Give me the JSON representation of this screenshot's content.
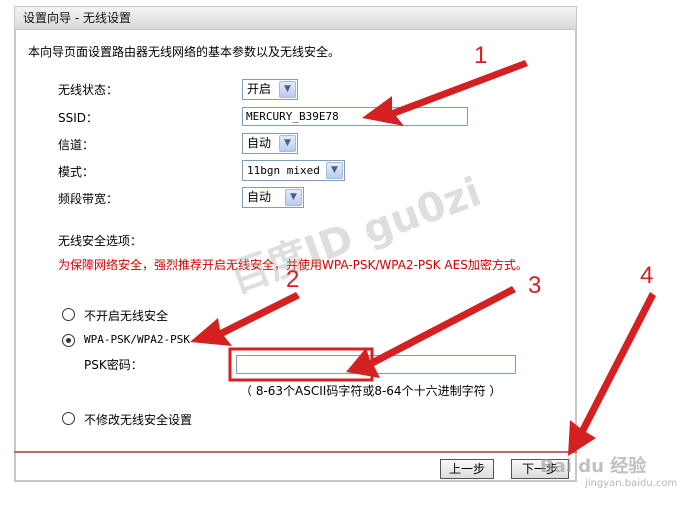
{
  "window": {
    "title": "设置向导 - 无线设置"
  },
  "intro": "本向导页面设置路由器无线网络的基本参数以及无线安全。",
  "fields": {
    "wireless_status": {
      "label": "无线状态：",
      "value": "开启"
    },
    "ssid": {
      "label": "SSID：",
      "value": "MERCURY_B39E78"
    },
    "channel": {
      "label": "信道：",
      "value": "自动"
    },
    "mode": {
      "label": "模式：",
      "value": "11bgn mixed"
    },
    "bandwidth": {
      "label": "频段带宽：",
      "value": "自动"
    }
  },
  "security": {
    "title": "无线安全选项：",
    "warning": "为保障网络安全，强烈推荐开启无线安全，并使用WPA-PSK/WPA2-PSK AES加密方式。",
    "options": [
      {
        "label": "不开启无线安全",
        "checked": false
      },
      {
        "label": "WPA-PSK/WPA2-PSK",
        "checked": true
      },
      {
        "label": "不修改无线安全设置",
        "checked": false
      }
    ],
    "psk_label": "PSK密码：",
    "psk_value": "",
    "psk_hint": "（ 8-63个ASCII码字符或8-64个十六进制字符 ）"
  },
  "buttons": {
    "prev": "上一步",
    "next": "下一步"
  },
  "annotations": [
    "1",
    "2",
    "3",
    "4"
  ],
  "watermark": "百度ID gu0zi",
  "corner_logo": "Bai du 经验",
  "corner_url": "jingyan.baidu.com",
  "colors": {
    "annotation": "#d42020",
    "warning": "#d40000"
  }
}
